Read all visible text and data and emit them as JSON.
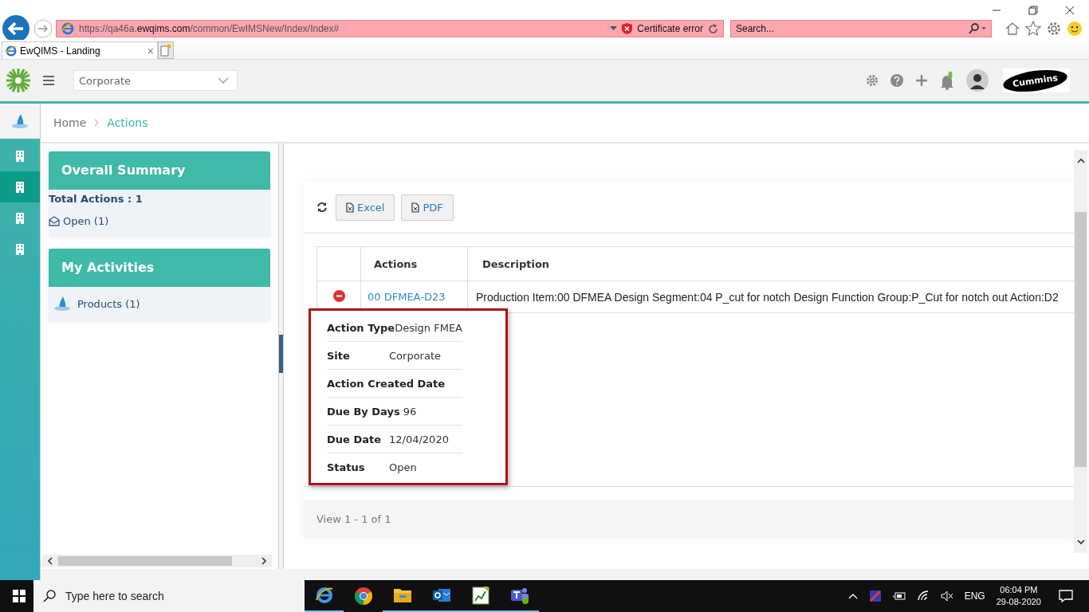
{
  "browser": {
    "url_start": "https://qa46a.",
    "url_domain": "ewqims.com",
    "url_end": "/common/EwIMSNew/Index/Index#",
    "certificate": "Certificate error",
    "search_placeholder": "Search...",
    "tab_title": "EwQIMS - Landing",
    "tab_close": "×"
  },
  "header": {
    "site": "Corporate",
    "logo_text": "Cummins"
  },
  "rail": [
    {
      "kind": "home",
      "selected": false
    },
    {
      "kind": "building",
      "selected": false
    },
    {
      "kind": "building",
      "selected": true
    },
    {
      "kind": "building",
      "selected": false
    },
    {
      "kind": "building",
      "selected": false
    }
  ],
  "breadcrumb": [
    "Home",
    "Actions"
  ],
  "summary": {
    "title": "Overall Summary",
    "total": "Total Actions : 1",
    "items": [
      "Open (1)"
    ]
  },
  "activities": {
    "title": "My Activities",
    "items": [
      "Products (1)"
    ]
  },
  "toolbar": [
    "Excel",
    "PDF"
  ],
  "table": {
    "columns": [
      "Actions",
      "Description"
    ],
    "rows": [
      {
        "action": "00 DFMEA-D23",
        "description": "Production Item:00 DFMEA Design Segment:04 P_cut for notch Design Function Group:P_Cut for notch out Action:D2"
      }
    ]
  },
  "tooltip": [
    {
      "label": "Action Type",
      "value": "Design FMEA"
    },
    {
      "label": "Site",
      "value": "Corporate"
    },
    {
      "label": "Action Created Date"
    },
    {
      "label": "Due By Days",
      "value": "96"
    },
    {
      "label": "Due Date",
      "value": "12/04/2020"
    },
    {
      "label": "Status",
      "value": "Open"
    }
  ],
  "pager": "View 1 - 1 of 1",
  "taskbar": {
    "search": "Type here to search",
    "lang": "ENG",
    "time": "06:04 PM",
    "date": "29-08-2020"
  }
}
